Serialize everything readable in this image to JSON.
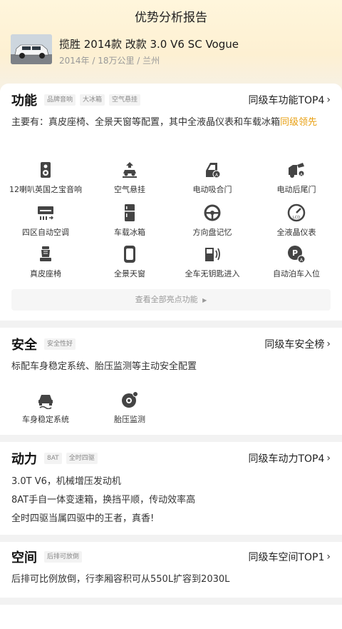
{
  "page": {
    "title": "优势分析报告"
  },
  "car": {
    "name": "揽胜 2014款 改款 3.0 V6 SC Vogue",
    "meta": "2014年 / 18万公里 / 兰州"
  },
  "features": {
    "title": "功能",
    "tags": [
      "品牌音响",
      "大冰箱",
      "空气悬挂"
    ],
    "rank_link": "同级车功能TOP4",
    "summary_prefix": "主要有：真皮座椅、全景天窗等配置，其中全液晶仪表和车载冰箱",
    "summary_highlight": "同级领先",
    "items": [
      {
        "label": "12喇叭英国之宝音响",
        "icon": "speaker-icon"
      },
      {
        "label": "空气悬挂",
        "icon": "air-suspension-icon"
      },
      {
        "label": "电动吸合门",
        "icon": "soft-close-door-icon"
      },
      {
        "label": "电动后尾门",
        "icon": "power-tailgate-icon"
      },
      {
        "label": "四区自动空调",
        "icon": "climate-control-icon"
      },
      {
        "label": "车载冰箱",
        "icon": "fridge-icon"
      },
      {
        "label": "方向盘记忆",
        "icon": "steering-wheel-icon"
      },
      {
        "label": "全液晶仪表",
        "icon": "lcd-gauge-icon"
      },
      {
        "label": "真皮座椅",
        "icon": "leather-seat-icon"
      },
      {
        "label": "全景天窗",
        "icon": "panoramic-roof-icon"
      },
      {
        "label": "全车无钥匙进入",
        "icon": "keyless-entry-icon"
      },
      {
        "label": "自动泊车入位",
        "icon": "auto-parking-icon"
      }
    ],
    "more_label": "查看全部亮点功能"
  },
  "safety": {
    "title": "安全",
    "tags": [
      "安全性好"
    ],
    "rank_link": "同级车安全榜",
    "summary": "标配车身稳定系统、胎压监测等主动安全配置",
    "items": [
      {
        "label": "车身稳定系统",
        "icon": "stability-control-icon"
      },
      {
        "label": "胎压监测",
        "icon": "tire-pressure-icon"
      }
    ]
  },
  "power": {
    "title": "动力",
    "tags": [
      "8AT",
      "全时四驱"
    ],
    "rank_link": "同级车动力TOP4",
    "lines": [
      "3.0T V6，机械增压发动机",
      "8AT手自一体变速箱，换挡平顺，传动效率高",
      "全时四驱当属四驱中的王者，真香!"
    ]
  },
  "space": {
    "title": "空间",
    "tags": [
      "后排可放倒"
    ],
    "rank_link": "同级车空间TOP1",
    "summary": "后排可比例放倒，行李厢容积可从550L扩容到2030L"
  }
}
